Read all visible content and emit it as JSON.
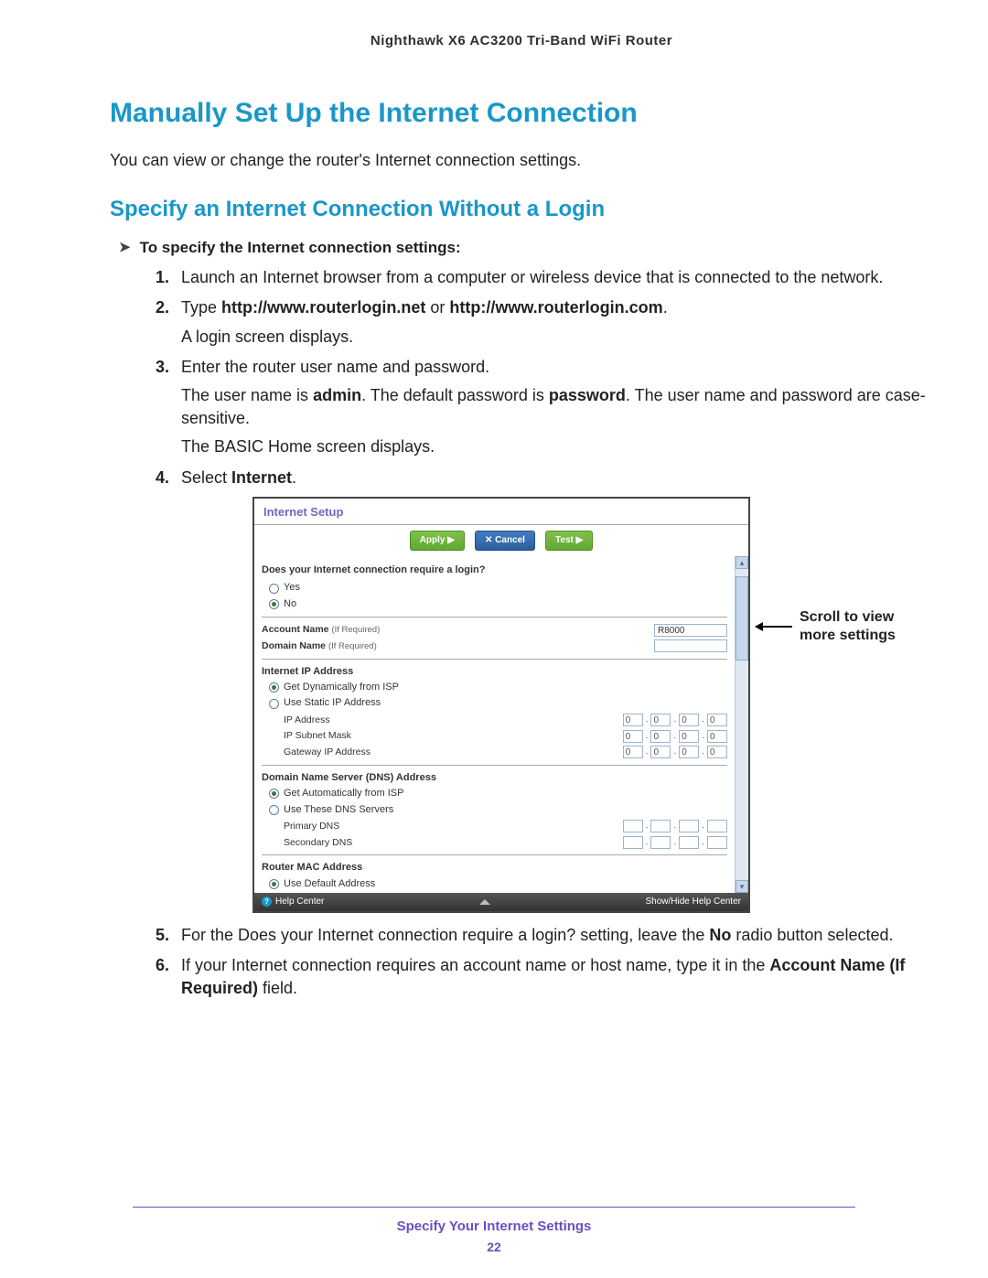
{
  "header": {
    "product": "Nighthawk X6 AC3200 Tri-Band WiFi Router"
  },
  "h1": "Manually Set Up the Internet Connection",
  "intro": "You can view or change the router's Internet connection settings.",
  "h2": "Specify an Internet Connection Without a Login",
  "task_title": "To specify the Internet connection settings:",
  "steps": {
    "s1": "Launch an Internet browser from a computer or wireless device that is connected to the network.",
    "s2_pre": "Type ",
    "s2_url1": "http://www.routerlogin.net",
    "s2_mid": " or ",
    "s2_url2": "http://www.routerlogin.com",
    "s2_post": ".",
    "s2_sub": "A login screen displays.",
    "s3": "Enter the router user name and password.",
    "s3_sub_a_pre": "The user name is ",
    "s3_admin": "admin",
    "s3_sub_a_mid": ". The default password is ",
    "s3_password": "password",
    "s3_sub_a_post": ". The user name and password are case-sensitive.",
    "s3_sub_b": "The BASIC Home screen displays.",
    "s4_pre": "Select ",
    "s4_bold": "Internet",
    "s4_post": ".",
    "s5_pre": "For the Does your Internet connection require a login? setting, leave the ",
    "s5_bold": "No",
    "s5_post": " radio button selected.",
    "s6_pre": "If your Internet connection requires an account name or host name, type it in the ",
    "s6_bold": "Account Name (If Required)",
    "s6_post": " field."
  },
  "screenshot": {
    "title": "Internet Setup",
    "btn_apply": "Apply ▶",
    "btn_cancel": "✕ Cancel",
    "btn_test": "Test ▶",
    "question": "Does your Internet connection require a login?",
    "opt_yes": "Yes",
    "opt_no": "No",
    "account_label": "Account Name ",
    "if_required": "(If Required)",
    "account_value": "R8000",
    "domain_label": "Domain Name ",
    "ip_section": "Internet IP Address",
    "ip_dyn": "Get Dynamically from ISP",
    "ip_static": "Use Static IP Address",
    "ip_address": "IP Address",
    "ip_subnet": "IP Subnet Mask",
    "ip_gateway": "Gateway IP Address",
    "ip_zero": "0",
    "dns_section": "Domain Name Server (DNS) Address",
    "dns_auto": "Get Automatically from ISP",
    "dns_use": "Use These DNS Servers",
    "dns_primary": "Primary DNS",
    "dns_secondary": "Secondary DNS",
    "mac_section": "Router MAC Address",
    "mac_default": "Use Default Address",
    "help_center": "Help Center",
    "show_hide": "Show/Hide Help Center"
  },
  "callout": "Scroll to view more settings",
  "footer": {
    "chapter": "Specify Your Internet Settings",
    "page": "22"
  }
}
